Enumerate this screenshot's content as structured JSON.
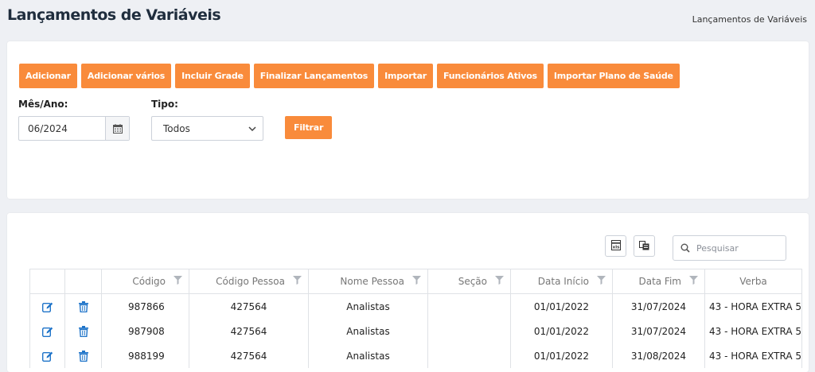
{
  "page": {
    "title": "Lançamentos de Variáveis",
    "breadcrumb": "Lançamentos de Variáveis"
  },
  "toolbar": {
    "buttons": [
      {
        "label": "Adicionar"
      },
      {
        "label": "Adicionar vários"
      },
      {
        "label": "Incluir Grade"
      },
      {
        "label": "Finalizar Lançamentos"
      },
      {
        "label": "Importar"
      },
      {
        "label": "Funcionários Ativos"
      },
      {
        "label": "Importar Plano de Saúde"
      }
    ]
  },
  "filters": {
    "mes_ano_label": "Mês/Ano:",
    "mes_ano_value": "06/2024",
    "tipo_label": "Tipo:",
    "tipo_value": "Todos",
    "filtrar_label": "Filtrar"
  },
  "grid_tools": {
    "search_placeholder": "Pesquisar",
    "icons": [
      "export-excel-icon",
      "column-chooser-icon"
    ]
  },
  "table": {
    "columns": [
      "Código",
      "Código Pessoa",
      "Nome Pessoa",
      "Seção",
      "Data Início",
      "Data Fim",
      "Verba"
    ],
    "rows": [
      {
        "codigo": "987866",
        "codigo_pessoa": "427564",
        "nome_pessoa": "Analistas",
        "secao": "",
        "data_inicio": "01/01/2022",
        "data_fim": "31/07/2024",
        "verba": "43 - HORA EXTRA 5"
      },
      {
        "codigo": "987908",
        "codigo_pessoa": "427564",
        "nome_pessoa": "Analistas",
        "secao": "",
        "data_inicio": "01/01/2022",
        "data_fim": "31/07/2024",
        "verba": "43 - HORA EXTRA 5"
      },
      {
        "codigo": "988199",
        "codigo_pessoa": "427564",
        "nome_pessoa": "Analistas",
        "secao": "",
        "data_inicio": "01/01/2022",
        "data_fim": "31/08/2024",
        "verba": "43 - HORA EXTRA 5"
      }
    ]
  },
  "colors": {
    "accent": "#f98b3b",
    "icon_blue": "#1f74c9",
    "filter_icon": "#b0b5bc"
  }
}
